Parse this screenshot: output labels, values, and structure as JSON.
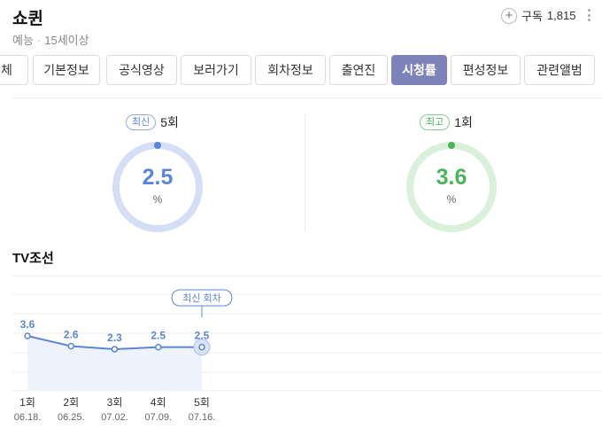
{
  "header": {
    "title": "쇼퀸",
    "genre": "예능",
    "rating": "15세이상",
    "subscribe_label": "구독",
    "subscribe_count": "1,815"
  },
  "tabs": [
    {
      "label": "전체"
    },
    {
      "label": "기본정보"
    },
    {
      "label": "공식영상"
    },
    {
      "label": "보러가기"
    },
    {
      "label": "회차정보"
    },
    {
      "label": "출연진"
    },
    {
      "label": "시청률",
      "active": true
    },
    {
      "label": "편성정보"
    },
    {
      "label": "관련앨범"
    }
  ],
  "latest": {
    "badge": "최신",
    "episode": "5회",
    "value": "2.5",
    "unit": "%"
  },
  "best": {
    "badge": "최고",
    "episode": "1회",
    "value": "3.6",
    "unit": "%"
  },
  "channel": "TV조선",
  "colors": {
    "accent": "#7d82b8",
    "blue": "#5b86d8",
    "green": "#4bb55a"
  },
  "chart_data": {
    "type": "area",
    "callout": "최신 회차",
    "points": [
      {
        "episode": "1회",
        "date": "06.18.",
        "value": 3.6
      },
      {
        "episode": "2회",
        "date": "06.25.",
        "value": 2.6
      },
      {
        "episode": "3회",
        "date": "07.02.",
        "value": 2.3
      },
      {
        "episode": "4회",
        "date": "07.09.",
        "value": 2.5
      },
      {
        "episode": "5회",
        "date": "07.16.",
        "value": 2.5
      }
    ],
    "grid": true
  }
}
